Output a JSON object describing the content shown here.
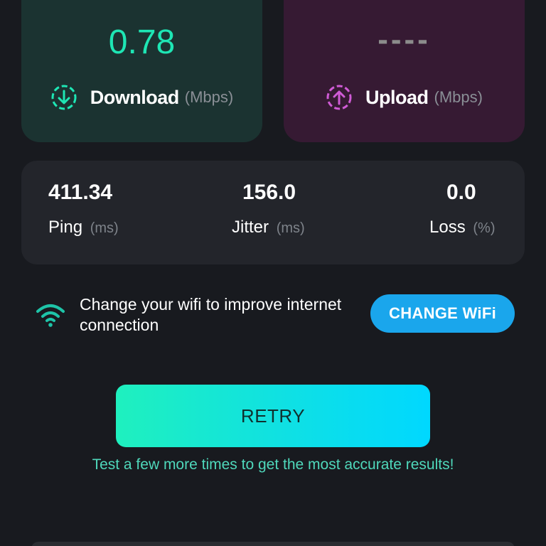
{
  "download": {
    "value": "0.78",
    "label": "Download",
    "unit": "(Mbps)",
    "icon": "download-circle-icon",
    "color": "#1ee6b4",
    "card_color": "#1b3331"
  },
  "upload": {
    "value": "----",
    "label": "Upload",
    "unit": "(Mbps)",
    "icon": "upload-circle-icon",
    "color": "#d05bd6",
    "card_color": "#361a33"
  },
  "stats": {
    "ping": {
      "value": "411.34",
      "label": "Ping",
      "unit": "(ms)"
    },
    "jitter": {
      "value": "156.0",
      "label": "Jitter",
      "unit": "(ms)"
    },
    "loss": {
      "value": "0.0",
      "label": "Loss",
      "unit": "(%)"
    }
  },
  "wifi_tip": {
    "icon": "wifi-icon",
    "text": "Change your wifi to improve internet connection",
    "button_label": "CHANGE WiFi",
    "button_color": "#1aa6ec"
  },
  "retry": {
    "label": "RETRY",
    "hint": "Test a few more times to get the most accurate results!"
  }
}
